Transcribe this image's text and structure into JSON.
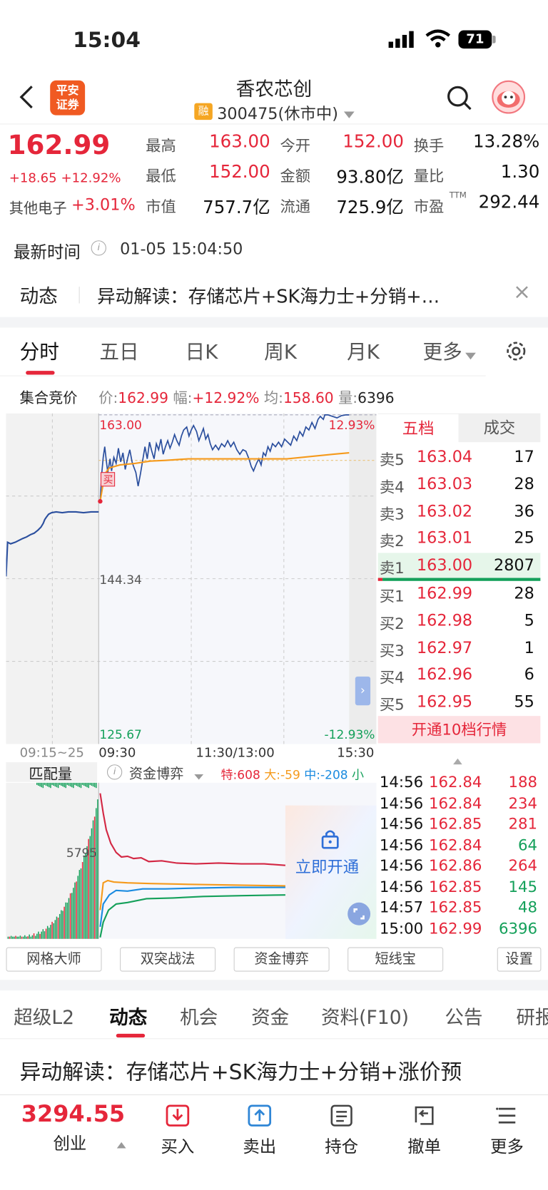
{
  "status_bar": {
    "time": "15:04",
    "battery": "71"
  },
  "header": {
    "broker_line1": "平安",
    "broker_line2": "证券",
    "title": "香农芯创",
    "rong_badge": "融",
    "code_status": "300475(休市中)"
  },
  "quote": {
    "price": "162.99",
    "change": "+18.65",
    "change_pct": "+12.92%",
    "sector_name": "其他电子",
    "sector_pct": "+3.01%",
    "stats": [
      {
        "label": "最高",
        "value": "163.00",
        "color": "red"
      },
      {
        "label": "今开",
        "value": "152.00",
        "color": "red"
      },
      {
        "label": "换手",
        "value": "13.28%",
        "color": "black"
      },
      {
        "label": "最低",
        "value": "152.00",
        "color": "red"
      },
      {
        "label": "金额",
        "value": "93.80亿",
        "color": "black"
      },
      {
        "label": "量比",
        "value": "1.30",
        "color": "black"
      },
      {
        "label": "市值",
        "value": "757.7亿",
        "color": "black"
      },
      {
        "label": "流通",
        "value": "725.9亿",
        "color": "black"
      },
      {
        "label": "市盈",
        "value": "292.44",
        "color": "black"
      }
    ],
    "pe_sup": "TTM"
  },
  "update": {
    "label": "最新时间",
    "info": "i",
    "time": "01-05 15:04:50"
  },
  "news": {
    "tag": "动态",
    "text": "异动解读：存储芯片+SK海力士+分销+…",
    "close": "×"
  },
  "chart_tabs": [
    "分时",
    "五日",
    "日K",
    "周K",
    "月K",
    "更多"
  ],
  "auction": {
    "label": "集合竞价",
    "price_l": "价:",
    "price": "162.99",
    "amp_l": "幅:",
    "amp": "+12.92%",
    "avg_l": "均:",
    "avg": "158.60",
    "vol_l": "量:",
    "vol": "6396"
  },
  "chart_labels": {
    "high": "163.00",
    "mid": "144.34",
    "low": "125.67",
    "high_pct": "12.93%",
    "low_pct": "-12.93%",
    "t_pre": "09:15~25",
    "t_open": "09:30",
    "t_mid": "11:30/13:00",
    "t_close": "15:30",
    "sell_marker": "买"
  },
  "sub_chart": {
    "match_label": "匹配量",
    "info": "i",
    "indicator": "资金博弈",
    "special_l": "特:",
    "special": "608",
    "large_l": "大:",
    "large": "-59",
    "medium_l": "中:",
    "medium": "-208",
    "small_l": "小",
    "level": "5795",
    "unlock": "立即开通"
  },
  "order_book": {
    "tab_five": "五档",
    "tab_trades": "成交",
    "asks": [
      {
        "label": "卖5",
        "price": "163.04",
        "vol": "17"
      },
      {
        "label": "卖4",
        "price": "163.03",
        "vol": "28"
      },
      {
        "label": "卖3",
        "price": "163.02",
        "vol": "36"
      },
      {
        "label": "卖2",
        "price": "163.01",
        "vol": "25"
      },
      {
        "label": "卖1",
        "price": "163.00",
        "vol": "2807"
      }
    ],
    "bids": [
      {
        "label": "买1",
        "price": "162.99",
        "vol": "28"
      },
      {
        "label": "买2",
        "price": "162.98",
        "vol": "5"
      },
      {
        "label": "买3",
        "price": "162.97",
        "vol": "1"
      },
      {
        "label": "买4",
        "price": "162.96",
        "vol": "6"
      },
      {
        "label": "买5",
        "price": "162.95",
        "vol": "55"
      }
    ],
    "level10": "开通10档行情"
  },
  "trades": [
    {
      "time": "14:56",
      "price": "162.84",
      "vol": "188",
      "dir": "buy"
    },
    {
      "time": "14:56",
      "price": "162.84",
      "vol": "234",
      "dir": "buy"
    },
    {
      "time": "14:56",
      "price": "162.85",
      "vol": "281",
      "dir": "buy"
    },
    {
      "time": "14:56",
      "price": "162.84",
      "vol": "64",
      "dir": "sell"
    },
    {
      "time": "14:56",
      "price": "162.86",
      "vol": "264",
      "dir": "buy"
    },
    {
      "time": "14:56",
      "price": "162.85",
      "vol": "145",
      "dir": "sell"
    },
    {
      "time": "14:57",
      "price": "162.85",
      "vol": "48",
      "dir": "sell"
    },
    {
      "time": "15:00",
      "price": "162.99",
      "vol": "6396",
      "dir": "sell"
    }
  ],
  "tool_buttons": [
    "网格大师",
    "双突战法",
    "资金博弈",
    "短线宝",
    "设置"
  ],
  "section_tabs": [
    "超级L2",
    "动态",
    "机会",
    "资金",
    "资料(F10)",
    "公告",
    "研报"
  ],
  "news_headline": "异动解读：存储芯片+SK海力士+分销+涨价预",
  "bottom": {
    "index_value": "3294.55",
    "index_name": "创业",
    "actions": [
      {
        "label": "买入",
        "icon": "buy-icon"
      },
      {
        "label": "卖出",
        "icon": "sell-icon"
      },
      {
        "label": "持仓",
        "icon": "position-icon"
      },
      {
        "label": "撤单",
        "icon": "cancel-order-icon"
      },
      {
        "label": "更多",
        "icon": "more-icon"
      }
    ]
  },
  "colors": {
    "up": "#e5263a",
    "down": "#14a05a",
    "avg_line": "#f59a1c",
    "price_line": "#2b4f9e",
    "accent": "#e5263a"
  }
}
